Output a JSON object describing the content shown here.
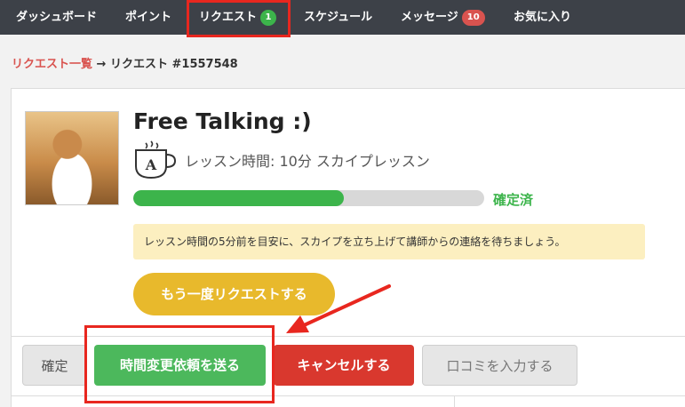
{
  "nav": {
    "items": [
      {
        "label": "ダッシュボード"
      },
      {
        "label": "ポイント"
      },
      {
        "label": "リクエスト",
        "badge": "1"
      },
      {
        "label": "スケジュール"
      },
      {
        "label": "メッセージ",
        "badge": "10"
      },
      {
        "label": "お気に入り"
      }
    ]
  },
  "breadcrumb": {
    "parent": "リクエスト一覧",
    "separator": "→",
    "current": "リクエスト #1557548"
  },
  "request": {
    "title": "Free Talking :)",
    "lesson_info": "レッスン時間: 10分 スカイプレッスン",
    "status": "確定済",
    "progress": 0.6,
    "notice": "レッスン時間の5分前を目安に、スカイプを立ち上げて講師からの連絡を待ちましょう。",
    "rerequest_label": "もう一度リクエストする",
    "cup_letter": "A"
  },
  "actions": {
    "confirm": "確定",
    "change_time": "時間変更依頼を送る",
    "cancel": "キャンセルする",
    "review": "口コミを入力する"
  },
  "colors": {
    "accent_green": "#4cb85c",
    "danger_red": "#d9382e",
    "highlight_red": "#e8271f",
    "nav_bg": "#3d4148",
    "button_yellow": "#e8b92c"
  },
  "icons": {
    "cup": "coffee-cup-icon",
    "arrow": "annotation-arrow"
  }
}
